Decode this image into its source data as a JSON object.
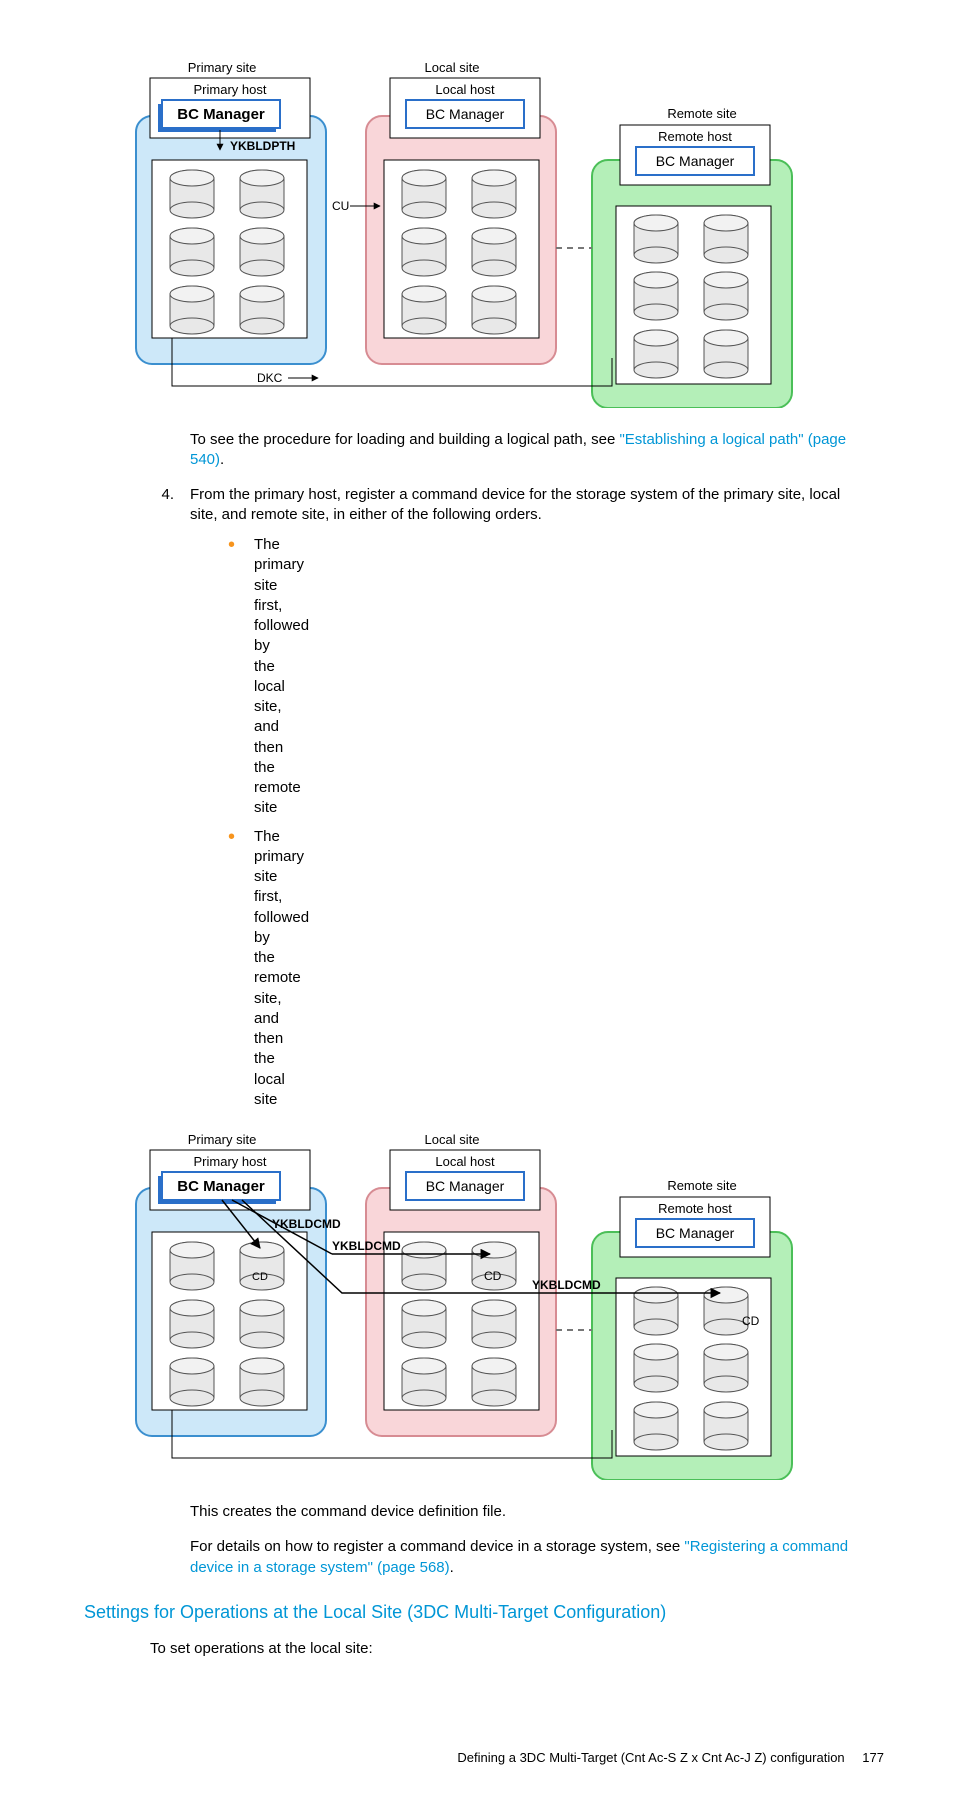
{
  "diagram1": {
    "primary_site": "Primary site",
    "local_site": "Local site",
    "remote_site": "Remote site",
    "primary_host": "Primary host",
    "local_host": "Local host",
    "remote_host": "Remote host",
    "bc_manager": "BC Manager",
    "ykbldpth": "YKBLDPTH",
    "cu": "CU",
    "dkc": "DKC"
  },
  "para1": {
    "prefix": "To see the procedure for loading and building a logical path, see ",
    "link": "\"Establishing a logical path\" (page 540)",
    "suffix": "."
  },
  "step4": {
    "num": "4.",
    "text": "From the primary host, register a command device for the storage system of the primary site, local site, and remote site, in either of the following orders."
  },
  "bullets": {
    "b1": "The primary site first, followed by the local site, and then the remote site",
    "b2": "The primary site first, followed by the remote site, and then the local site"
  },
  "diagram2": {
    "primary_site": "Primary site",
    "local_site": "Local site",
    "remote_site": "Remote site",
    "primary_host": "Primary host",
    "local_host": "Local host",
    "remote_host": "Remote host",
    "bc_manager": "BC Manager",
    "ykbldcmd1": "YKBLDCMD",
    "ykbldcmd2": "YKBLDCMD",
    "ykbldcmd3": "YKBLDCMD",
    "cd": "CD"
  },
  "para2": "This creates the command device definition file.",
  "para3": {
    "prefix": "For details on how to register a command device in a storage system, see ",
    "link": "\"Registering a command device in a storage system\" (page 568)",
    "suffix": "."
  },
  "heading": "Settings for Operations at the Local Site (3DC Multi-Target Configuration)",
  "para4": "To set operations at the local site:",
  "footer": {
    "text": "Defining a 3DC Multi-Target (Cnt Ac-S Z x Cnt Ac-J Z) configuration",
    "page": "177"
  }
}
